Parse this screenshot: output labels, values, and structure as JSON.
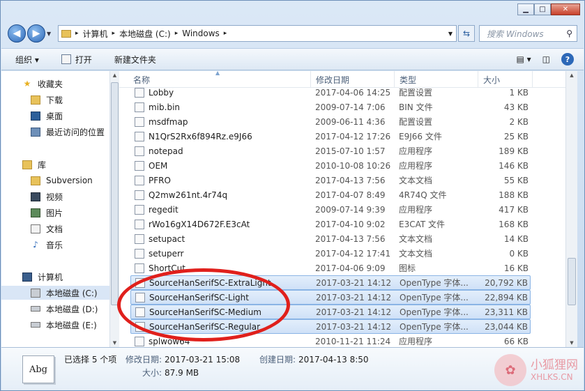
{
  "window": {
    "minimize": "▁",
    "maximize": "□",
    "close": "✕"
  },
  "address": {
    "path": [
      "计算机",
      "本地磁盘 (C:)",
      "Windows"
    ],
    "separator": "▸"
  },
  "search": {
    "placeholder": "搜索 Windows"
  },
  "toolbar": {
    "organize": "组织 ▾",
    "open": "打开",
    "new_folder": "新建文件夹"
  },
  "nav": {
    "favorites": "收藏夹",
    "downloads": "下载",
    "desktop": "桌面",
    "recent": "最近访问的位置",
    "libraries": "库",
    "subversion": "Subversion",
    "videos": "视频",
    "pictures": "图片",
    "documents": "文档",
    "music": "音乐",
    "computer": "计算机",
    "drive_c": "本地磁盘 (C:)",
    "drive_d": "本地磁盘 (D:)",
    "drive_e": "本地磁盘 (E:)"
  },
  "columns": {
    "name": "名称",
    "date": "修改日期",
    "type": "类型",
    "size": "大小"
  },
  "files": [
    {
      "name": "Lobby",
      "date": "2017-04-06 14:25",
      "type": "配置设置",
      "size": "1 KB",
      "selected": false
    },
    {
      "name": "mib.bin",
      "date": "2009-07-14 7:06",
      "type": "BIN 文件",
      "size": "43 KB",
      "selected": false
    },
    {
      "name": "msdfmap",
      "date": "2009-06-11 4:36",
      "type": "配置设置",
      "size": "2 KB",
      "selected": false
    },
    {
      "name": "N1QrS2Rx6f894Rz.e9J66",
      "date": "2017-04-12 17:26",
      "type": "E9J66 文件",
      "size": "25 KB",
      "selected": false
    },
    {
      "name": "notepad",
      "date": "2015-07-10 1:57",
      "type": "应用程序",
      "size": "189 KB",
      "selected": false
    },
    {
      "name": "OEM",
      "date": "2010-10-08 10:26",
      "type": "应用程序",
      "size": "146 KB",
      "selected": false
    },
    {
      "name": "PFRO",
      "date": "2017-04-13 7:56",
      "type": "文本文档",
      "size": "55 KB",
      "selected": false
    },
    {
      "name": "Q2mw261nt.4r74q",
      "date": "2017-04-07 8:49",
      "type": "4R74Q 文件",
      "size": "188 KB",
      "selected": false
    },
    {
      "name": "regedit",
      "date": "2009-07-14 9:39",
      "type": "应用程序",
      "size": "417 KB",
      "selected": false
    },
    {
      "name": "rWo16gX14D672F.E3cAt",
      "date": "2017-04-10 9:02",
      "type": "E3CAT 文件",
      "size": "168 KB",
      "selected": false
    },
    {
      "name": "setupact",
      "date": "2017-04-13 7:56",
      "type": "文本文档",
      "size": "14 KB",
      "selected": false
    },
    {
      "name": "setuperr",
      "date": "2017-04-12 17:41",
      "type": "文本文档",
      "size": "0 KB",
      "selected": false
    },
    {
      "name": "ShortCut",
      "date": "2017-04-06 9:09",
      "type": "图标",
      "size": "16 KB",
      "selected": false
    },
    {
      "name": "SourceHanSerifSC-ExtraLight",
      "date": "2017-03-21 14:12",
      "type": "OpenType 字体...",
      "size": "20,792 KB",
      "selected": true
    },
    {
      "name": "SourceHanSerifSC-Light",
      "date": "2017-03-21 14:12",
      "type": "OpenType 字体...",
      "size": "22,894 KB",
      "selected": true
    },
    {
      "name": "SourceHanSerifSC-Medium",
      "date": "2017-03-21 14:12",
      "type": "OpenType 字体...",
      "size": "23,311 KB",
      "selected": true
    },
    {
      "name": "SourceHanSerifSC-Regular",
      "date": "2017-03-21 14:12",
      "type": "OpenType 字体...",
      "size": "23,044 KB",
      "selected": true
    },
    {
      "name": "splwow64",
      "date": "2010-11-21 11:24",
      "type": "应用程序",
      "size": "66 KB",
      "selected": false
    }
  ],
  "status": {
    "selected_count": "已选择 5 个项",
    "modified_label": "修改日期:",
    "modified_value": "2017-03-21 15:08",
    "created_label": "创建日期:",
    "created_value": "2017-04-13 8:50",
    "size_label": "大小:",
    "size_value": "87.9 MB",
    "thumb_text": "Abg"
  },
  "watermark": {
    "title": "小狐狸网",
    "url": "XHLKS.CN"
  }
}
